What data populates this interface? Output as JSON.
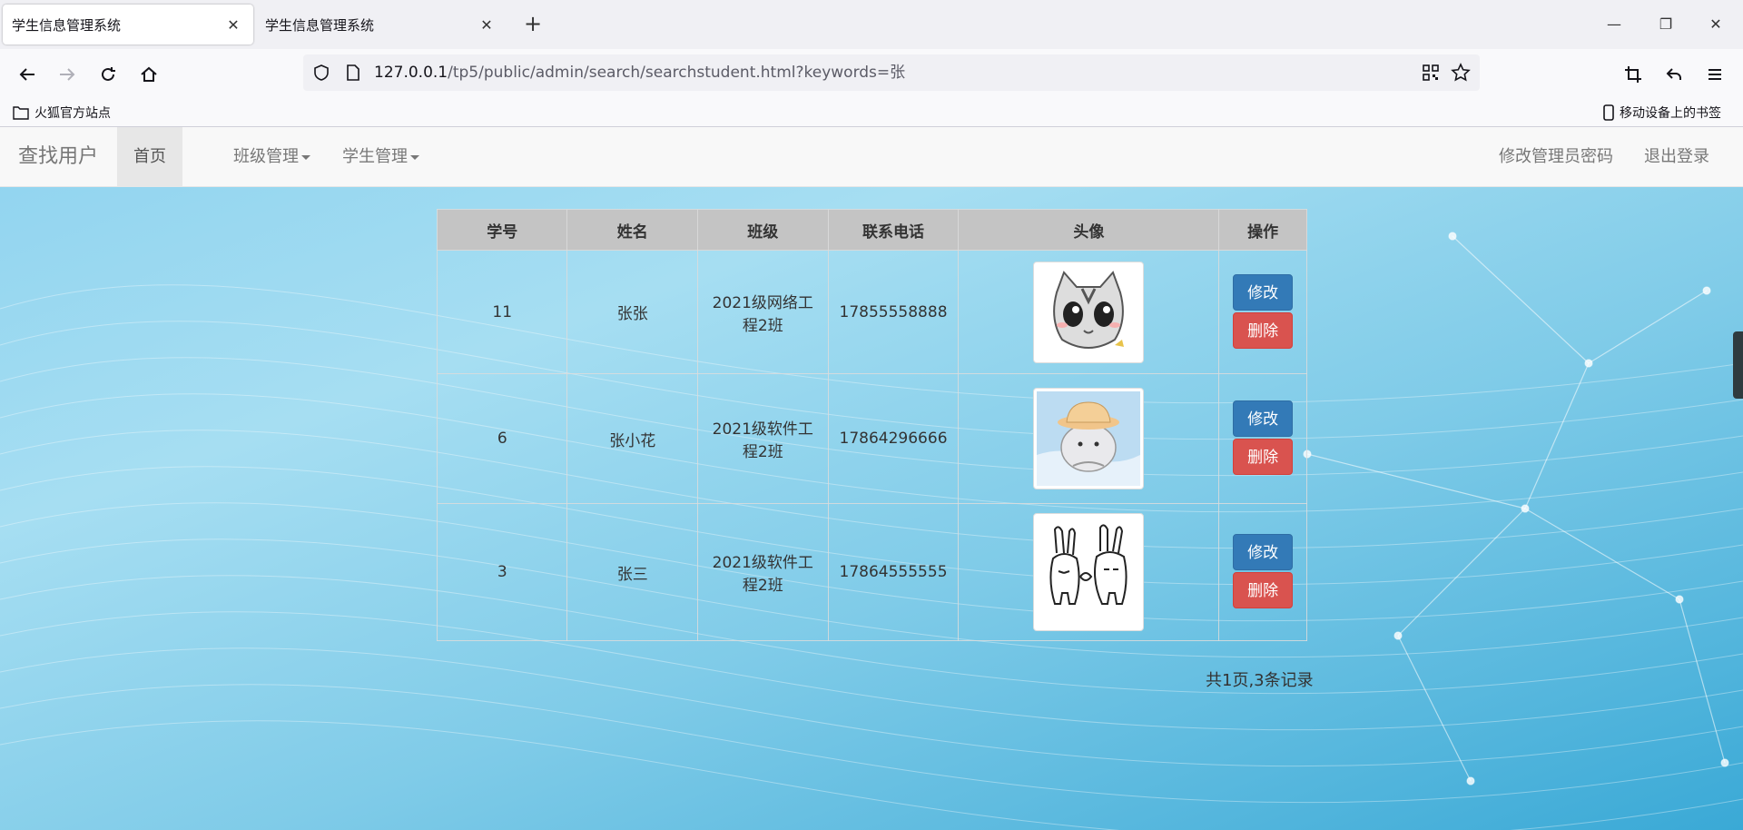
{
  "browser": {
    "tabs": [
      {
        "title": "学生信息管理系统",
        "active": true
      },
      {
        "title": "学生信息管理系统",
        "active": false
      }
    ],
    "url_host": "127.0.0.1",
    "url_path": "/tp5/public/admin/search/searchstudent.html?keywords=张",
    "bookmarks_left": "火狐官方站点",
    "bookmarks_right": "移动设备上的书签"
  },
  "app": {
    "brand": "查找用户",
    "nav": {
      "home": "首页",
      "class_mgmt": "班级管理",
      "student_mgmt": "学生管理",
      "change_password": "修改管理员密码",
      "logout": "退出登录"
    },
    "table": {
      "headers": [
        "学号",
        "姓名",
        "班级",
        "联系电话",
        "头像",
        "操作"
      ],
      "rows": [
        {
          "id": "11",
          "name": "张张",
          "class_line1": "2021级网络工",
          "class_line2": "程2班",
          "phone": "17855558888",
          "avatar": "cat-avatar"
        },
        {
          "id": "6",
          "name": "张小花",
          "class_line1": "2021级软件工",
          "class_line2": "程2班",
          "phone": "17864296666",
          "avatar": "hat-bear-avatar"
        },
        {
          "id": "3",
          "name": "张三",
          "class_line1": "2021级软件工",
          "class_line2": "程2班",
          "phone": "17864555555",
          "avatar": "rabbits-avatar"
        }
      ],
      "edit_label": "修改",
      "delete_label": "删除"
    },
    "pagination": "共1页,3条记录"
  },
  "colors": {
    "edit_button": "#337ab7",
    "delete_button": "#d9534f",
    "page_background": "#8fd3ef"
  }
}
